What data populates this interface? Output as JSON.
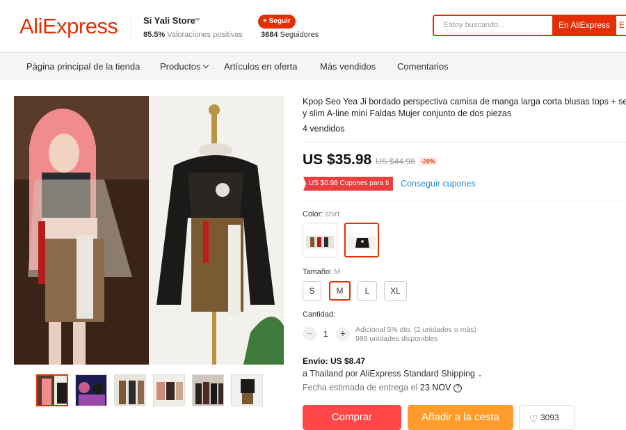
{
  "header": {
    "logo": "AliExpress",
    "store_name": "Si Yali Store",
    "rating_value": "85.5%",
    "rating_label": "Valoraciones positivas",
    "follow_label": "+ Seguir",
    "followers_count": "3684",
    "followers_label": "Seguidores",
    "search_placeholder": "Estoy buscando...",
    "search_button": "En AliExpress",
    "search_button_2": "E"
  },
  "nav": {
    "items": [
      "Página principal de la tienda",
      "Productos",
      "Artículos en oferta",
      "Más vendidos",
      "Comentarios"
    ]
  },
  "product": {
    "title_line1": "Kpop Seo Yea Ji bordado perspectiva camisa de manga larga corta blusas tops + sex",
    "title_line2": "y slim A-line mini Faldas Mujer conjunto de dos piezas",
    "sold": "4 vendidos",
    "price": "US $35.98",
    "old_price": "US $44.98",
    "discount": "-20%",
    "coupon_tag": "US $0.98 Cupones para ti",
    "coupon_link": "Conseguir cupones",
    "color_label": "Color:",
    "color_value": "shirt",
    "size_label": "Tamaño:",
    "size_value": "M",
    "sizes": [
      "S",
      "M",
      "L",
      "XL"
    ],
    "quantity_label": "Cantidad:",
    "quantity": "1",
    "qty_minus": "−",
    "qty_plus": "+",
    "qty_info_1": "Adicional 5% dto. (2 unidades o más)",
    "qty_info_2": "989 unidades disponibles",
    "shipping_cost": "Envío: US $8.47",
    "shipping_method": "a Thailand por AliExpress Standard Shipping",
    "delivery_label": "Fecha estimada de entrega el",
    "delivery_date": "23 NOV",
    "help_icon": "?",
    "buy_label": "Comprar",
    "cart_label": "Añadir a la cesta",
    "wishlist_count": "3093"
  },
  "colors": {
    "accent": "#e62e04",
    "coupon": "#ea3f3f",
    "link": "#2a8bd4",
    "buy": "#ff4747",
    "cart": "#ff9c2b"
  },
  "icons": [
    "chevron-down-icon",
    "help-icon",
    "heart-icon"
  ]
}
